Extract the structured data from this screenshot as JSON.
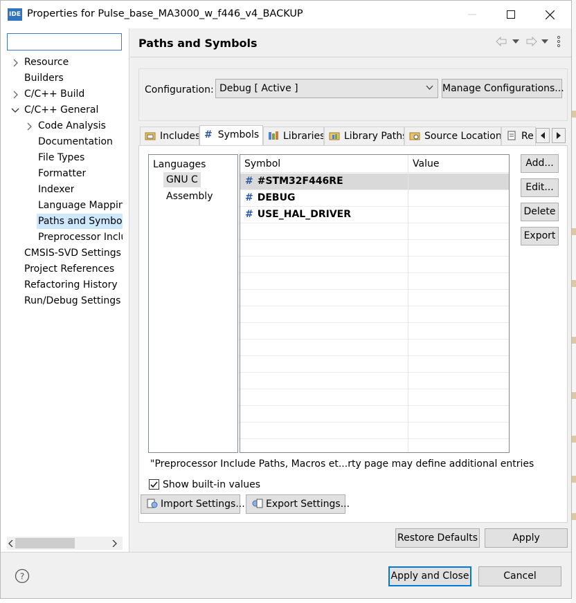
{
  "window": {
    "app_badge": "IDE",
    "title": "Properties for Pulse_base_MA3000_w_f446_v4_BACKUP"
  },
  "nav": {
    "filter_value": "",
    "items": [
      {
        "label": "Resource"
      },
      {
        "label": "Builders"
      },
      {
        "label": "C/C++ Build"
      },
      {
        "label": "C/C++ General"
      },
      {
        "label": "Code Analysis"
      },
      {
        "label": "Documentation"
      },
      {
        "label": "File Types"
      },
      {
        "label": "Formatter"
      },
      {
        "label": "Indexer"
      },
      {
        "label": "Language Mappin"
      },
      {
        "label": "Paths and Symbols"
      },
      {
        "label": "Preprocessor Inclu"
      },
      {
        "label": "CMSIS-SVD Settings"
      },
      {
        "label": "Project References"
      },
      {
        "label": "Refactoring History"
      },
      {
        "label": "Run/Debug Settings"
      }
    ]
  },
  "page": {
    "title": "Paths and Symbols",
    "config_label": "Configuration:",
    "config_value": "Debug  [ Active ]",
    "manage_label": "Manage Configurations...",
    "tabs": [
      {
        "label": "Includes"
      },
      {
        "label": "Symbols"
      },
      {
        "label": "Libraries"
      },
      {
        "label": "Library Paths"
      },
      {
        "label": "Source Location"
      },
      {
        "label": "Re"
      }
    ],
    "languages_header": "Languages",
    "languages": [
      "GNU C",
      "Assembly"
    ],
    "table": {
      "headers": [
        "Symbol",
        "Value"
      ],
      "rows": [
        {
          "symbol": "#STM32F446RE",
          "value": ""
        },
        {
          "symbol": "DEBUG",
          "value": ""
        },
        {
          "symbol": "USE_HAL_DRIVER",
          "value": ""
        }
      ]
    },
    "hash_glyph": "#",
    "side_buttons": [
      "Add...",
      "Edit...",
      "Delete",
      "Export"
    ],
    "note": "\"Preprocessor Include Paths, Macros et...rty page may define additional entries",
    "show_builtin_label": "Show built-in values",
    "show_builtin_checked": true,
    "import_label": "Import Settings...",
    "export_label": "Export Settings...",
    "restore_label": "Restore Defaults",
    "apply_label": "Apply"
  },
  "footer": {
    "apply_close_label": "Apply and Close",
    "cancel_label": "Cancel"
  },
  "colors": {
    "accent": "#0078d7",
    "selection": "#cde8ff",
    "hash": "#2c5aa0"
  }
}
